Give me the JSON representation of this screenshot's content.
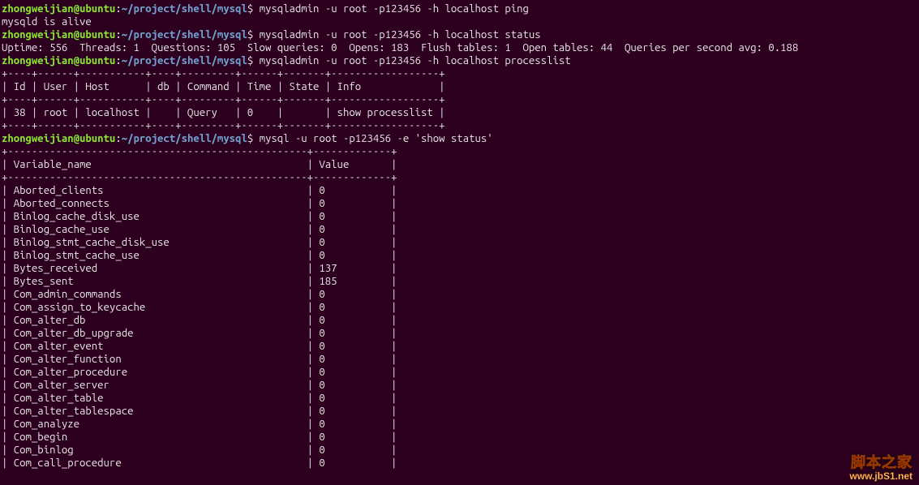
{
  "prompt": {
    "user": "zhongweijian@ubuntu",
    "path": "~/project/shell/mysql",
    "sep": ":",
    "dollar": "$"
  },
  "commands": {
    "cmd1": "mysqladmin -u root -p123456 -h localhost ping",
    "out1": "mysqld is alive",
    "cmd2": "mysqladmin -u root -p123456 -h localhost status",
    "out2": "Uptime: 556  Threads: 1  Questions: 105  Slow queries: 0  Opens: 183  Flush tables: 1  Open tables: 44  Queries per second avg: 0.188",
    "cmd3": "mysqladmin -u root -p123456 -h localhost processlist",
    "cmd4": "mysql -u root -p123456 -e 'show status'"
  },
  "processlist": {
    "border": "+----+------+-----------+----+---------+------+-------+------------------+",
    "header": "| Id | User | Host      | db | Command | Time | State | Info             |",
    "row": "| 38 | root | localhost |    | Query   | 0    |       | show processlist |"
  },
  "status": {
    "border": "+--------------------------------------------------+-------------+",
    "header": "| Variable_name                                    | Value       |",
    "rows": [
      {
        "name": "Aborted_clients",
        "value": "0"
      },
      {
        "name": "Aborted_connects",
        "value": "0"
      },
      {
        "name": "Binlog_cache_disk_use",
        "value": "0"
      },
      {
        "name": "Binlog_cache_use",
        "value": "0"
      },
      {
        "name": "Binlog_stmt_cache_disk_use",
        "value": "0"
      },
      {
        "name": "Binlog_stmt_cache_use",
        "value": "0"
      },
      {
        "name": "Bytes_received",
        "value": "137"
      },
      {
        "name": "Bytes_sent",
        "value": "185"
      },
      {
        "name": "Com_admin_commands",
        "value": "0"
      },
      {
        "name": "Com_assign_to_keycache",
        "value": "0"
      },
      {
        "name": "Com_alter_db",
        "value": "0"
      },
      {
        "name": "Com_alter_db_upgrade",
        "value": "0"
      },
      {
        "name": "Com_alter_event",
        "value": "0"
      },
      {
        "name": "Com_alter_function",
        "value": "0"
      },
      {
        "name": "Com_alter_procedure",
        "value": "0"
      },
      {
        "name": "Com_alter_server",
        "value": "0"
      },
      {
        "name": "Com_alter_table",
        "value": "0"
      },
      {
        "name": "Com_alter_tablespace",
        "value": "0"
      },
      {
        "name": "Com_analyze",
        "value": "0"
      },
      {
        "name": "Com_begin",
        "value": "0"
      },
      {
        "name": "Com_binlog",
        "value": "0"
      },
      {
        "name": "Com_call_procedure",
        "value": "0"
      }
    ],
    "nameColWidth": 48,
    "valueColWidth": 11
  },
  "watermark": {
    "line1": "脚本之家",
    "line2": "www.jbS1.net"
  }
}
